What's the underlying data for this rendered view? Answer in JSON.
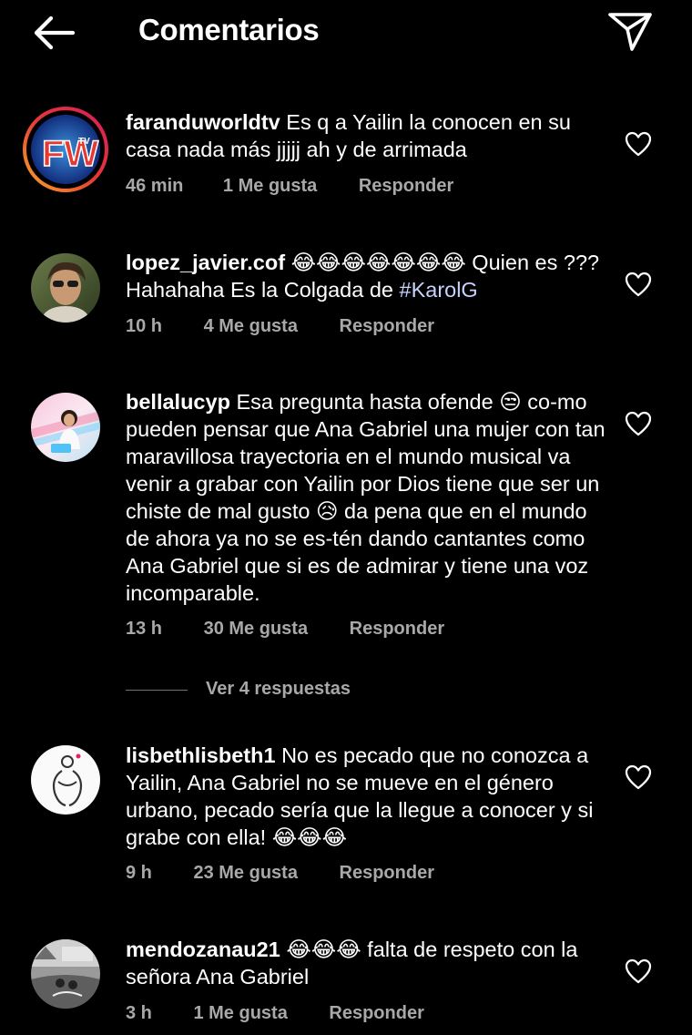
{
  "header": {
    "title": "Comentarios"
  },
  "comments": [
    {
      "username": "faranduworldtv",
      "text": "Es q a Yailin la conocen en su casa nada más jjjjj ah y de arrimada",
      "time": "46 min",
      "likes": "1 Me gusta",
      "reply": "Responder",
      "avatar_logo": "FW",
      "avatar_logo_tag": "TV"
    },
    {
      "username": "lopez_javier.cof",
      "text_before": "😂😂😂😂😂😂😂 Quien es ??? Hahahaha Es la Colgada de ",
      "hashtag": "#KarolG",
      "time": "10 h",
      "likes": "4 Me gusta",
      "reply": "Responder"
    },
    {
      "username": "bellalucyp",
      "text": "Esa pregunta hasta ofende 😒 co-mo pueden pensar que Ana Gabriel una mujer con tan maravillosa trayectoria en el mundo musical va venir a grabar con Yailin por Dios tiene que ser un chiste de mal gusto 😥 da pena que en el mundo de ahora ya no se es-tén dando cantantes como Ana Gabriel que si es de admirar y tiene una voz incomparable.",
      "time": "13 h",
      "likes": "30 Me gusta",
      "reply": "Responder",
      "view_replies": "Ver 4 respuestas"
    },
    {
      "username": "lisbethlisbeth1",
      "text": "No es pecado que no conozca a Yailin, Ana Gabriel no se mueve en el género urbano, pecado sería que la llegue a conocer y si grabe con ella! 😂😂😂",
      "time": "9 h",
      "likes": "23 Me gusta",
      "reply": "Responder"
    },
    {
      "username": "mendozanau21",
      "text": "😂😂😂 falta de respeto con la señora Ana Gabriel",
      "time": "3 h",
      "likes": "1 Me gusta",
      "reply": "Responder"
    }
  ],
  "icons": {
    "back": "arrow-left-icon",
    "send": "paper-plane-icon",
    "like": "heart-outline-icon"
  },
  "colors": {
    "background": "#000000",
    "text": "#ffffff",
    "meta_text": "#a8a8a8",
    "hashtag": "#c7d2fe",
    "story_ring_start": "#f9a825",
    "story_ring_end": "#d81b60"
  }
}
